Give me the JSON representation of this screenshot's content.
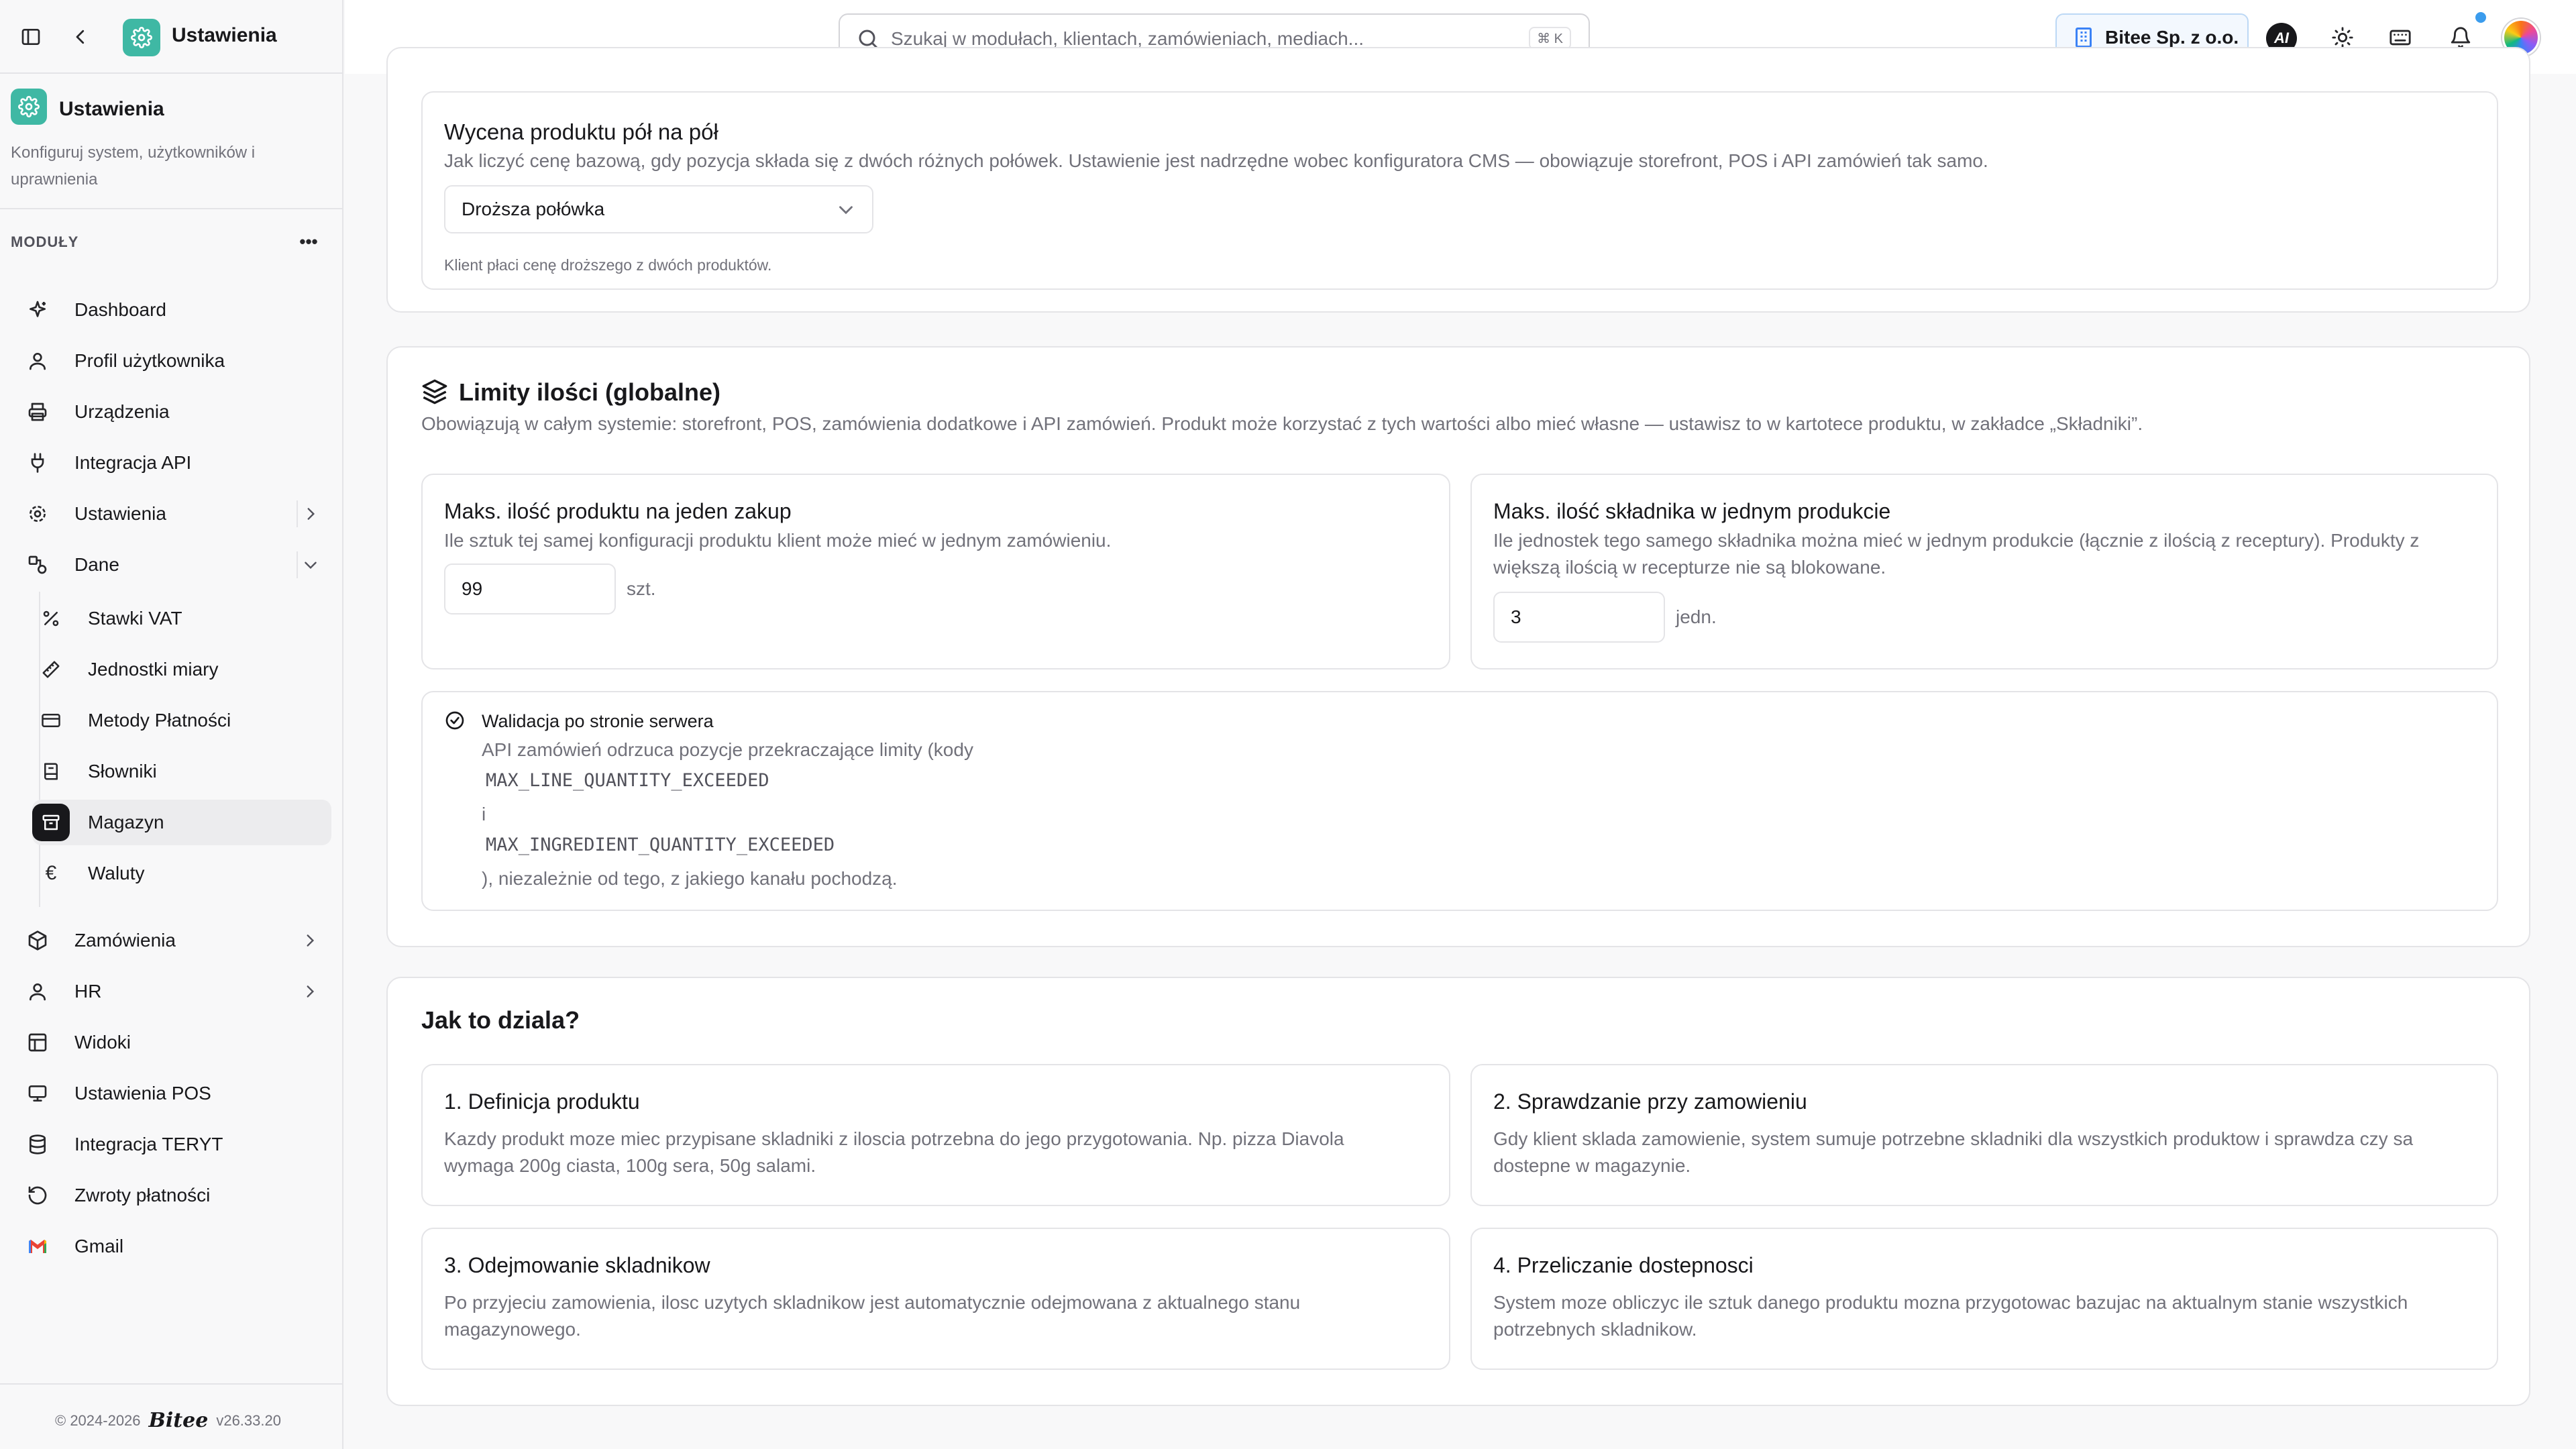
{
  "app": {
    "name": "Ustawienia",
    "icon": "gear-icon",
    "accent": "#3fb8a4"
  },
  "sidebar": {
    "title": "Ustawienia",
    "description": "Konfiguruj system, użytkowników i uprawnienia",
    "modules_label": "MODUŁY",
    "more_label": "•••",
    "items": [
      {
        "label": "Dashboard",
        "icon": "sparkle-icon"
      },
      {
        "label": "Profil użytkownika",
        "icon": "user-icon"
      },
      {
        "label": "Urządzenia",
        "icon": "printer-icon"
      },
      {
        "label": "Integracja API",
        "icon": "plug-icon"
      },
      {
        "label": "Ustawienia",
        "icon": "gear-icon"
      },
      {
        "label": "Dane",
        "icon": "shapes-icon"
      },
      {
        "label": "Zamówienia",
        "icon": "package-icon"
      },
      {
        "label": "HR",
        "icon": "user-icon"
      },
      {
        "label": "Widoki",
        "icon": "layout-icon"
      },
      {
        "label": "Ustawienia POS",
        "icon": "monitor-icon"
      },
      {
        "label": "Integracja TERYT",
        "icon": "database-icon"
      },
      {
        "label": "Zwroty płatności",
        "icon": "rotate-ccw-icon"
      },
      {
        "label": "Gmail",
        "icon": "gmail-icon"
      }
    ],
    "sub_items": [
      {
        "label": "Stawki VAT",
        "icon": "percent-icon"
      },
      {
        "label": "Jednostki miary",
        "icon": "ruler-icon"
      },
      {
        "label": "Metody Płatności",
        "icon": "credit-card-icon"
      },
      {
        "label": "Słowniki",
        "icon": "book-icon"
      },
      {
        "label": "Magazyn",
        "icon": "archive-icon",
        "active": true
      },
      {
        "label": "Waluty",
        "icon": "euro-icon"
      }
    ],
    "footer": {
      "copyright": "© 2024-2026",
      "brand": "Bitee",
      "version": "v26.33.20"
    }
  },
  "topbar": {
    "search_placeholder": "Szukaj w modułach, klientach, zamówieniach, mediach...",
    "search_shortcut": "⌘ K",
    "org_name": "Bitee Sp. z o.o.",
    "ai_label": "AI"
  },
  "pricing": {
    "title": "Wycena produktu pół na pół",
    "description": "Jak liczyć cenę bazową, gdy pozycja składa się z dwóch różnych połówek. Ustawienie jest nadrzędne wobec konfiguratora CMS — obowiązuje storefront, POS i API zamówień tak samo.",
    "select_value": "Droższa połówka",
    "hint": "Klient płaci cenę droższego z dwóch produktów."
  },
  "limits": {
    "title": "Limity ilości (globalne)",
    "description": "Obowiązują w całym systemie: storefront, POS, zamówienia dodatkowe i API zamówień. Produkt może korzystać z tych wartości albo mieć własne — ustawisz to w kartotece produktu, w zakładce „Składniki”.",
    "max_product": {
      "title": "Maks. ilość produktu na jeden zakup",
      "description": "Ile sztuk tej samej konfiguracji produktu klient może mieć w jednym zamówieniu.",
      "value": "99",
      "unit": "szt."
    },
    "max_ingredient": {
      "title": "Maks. ilość składnika w jednym produkcie",
      "description": "Ile jednostek tego samego składnika można mieć w jednym produkcie (łącznie z ilością z receptury). Produkty z większą ilością w recepturze nie są blokowane.",
      "value": "3",
      "unit": "jedn."
    },
    "validation": {
      "title": "Walidacja po stronie serwera",
      "line1": "API zamówień odrzuca pozycje przekraczające limity (kody",
      "code1": "MAX_LINE_QUANTITY_EXCEEDED",
      "conj": "i",
      "code2": "MAX_INGREDIENT_QUANTITY_EXCEEDED",
      "line2": "), niezależnie od tego, z jakiego kanału pochodzą."
    }
  },
  "how": {
    "title": "Jak to dziala?",
    "steps": [
      {
        "title": "1. Definicja produktu",
        "text": "Kazdy produkt moze miec przypisane skladniki z iloscia potrzebna do jego przygotowania. Np. pizza Diavola wymaga 200g ciasta, 100g sera, 50g salami."
      },
      {
        "title": "2. Sprawdzanie przy zamowieniu",
        "text": "Gdy klient sklada zamowienie, system sumuje potrzebne skladniki dla wszystkich produktow i sprawdza czy sa dostepne w magazynie."
      },
      {
        "title": "3. Odejmowanie skladnikow",
        "text": "Po przyjeciu zamowienia, ilosc uzytych skladnikow jest automatycznie odejmowana z aktualnego stanu magazynowego."
      },
      {
        "title": "4. Przeliczanie dostepnosci",
        "text": "System moze obliczyc ile sztuk danego produktu mozna przygotowac bazujac na aktualnym stanie wszystkich potrzebnych skladnikow."
      }
    ]
  }
}
